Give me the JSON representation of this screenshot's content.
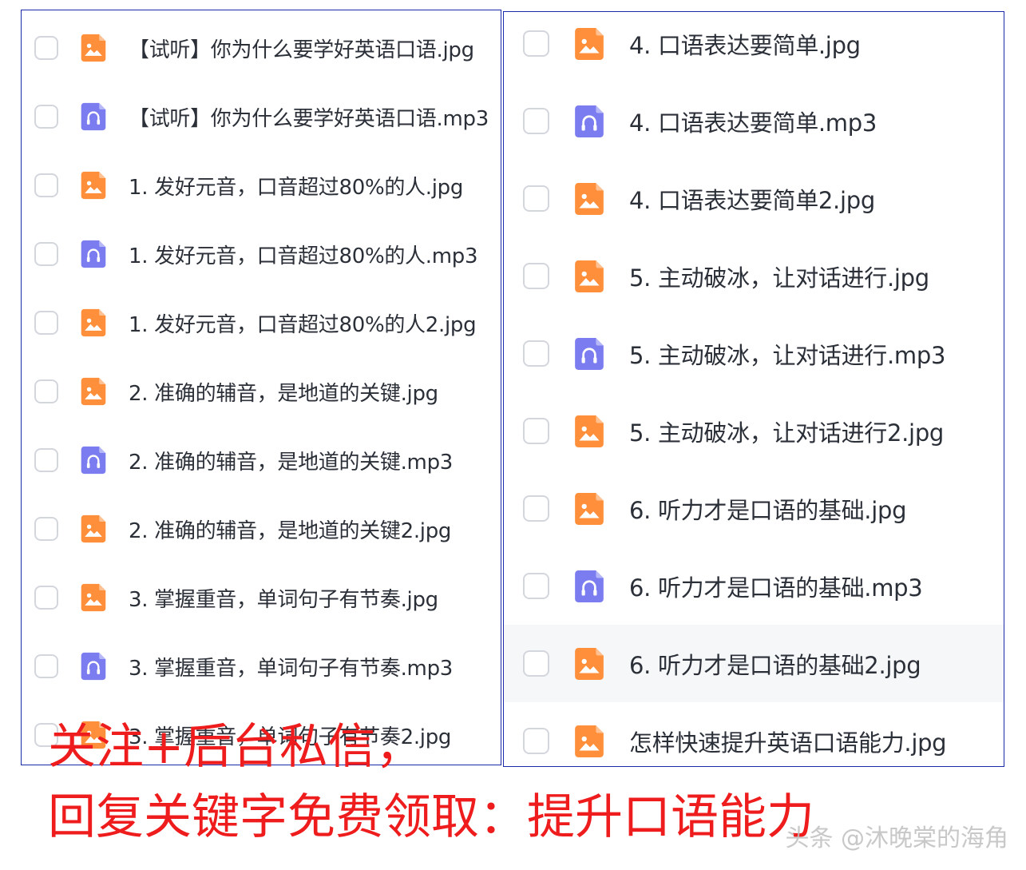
{
  "left_panel": {
    "files": [
      {
        "name": "【试听】你为什么要学好英语口语.jpg",
        "type": "image"
      },
      {
        "name": "【试听】你为什么要学好英语口语.mp3",
        "type": "audio"
      },
      {
        "name": "1. 发好元音，口音超过80%的人.jpg",
        "type": "image"
      },
      {
        "name": "1. 发好元音，口音超过80%的人.mp3",
        "type": "audio"
      },
      {
        "name": "1. 发好元音，口音超过80%的人2.jpg",
        "type": "image"
      },
      {
        "name": "2. 准确的辅音，是地道的关键.jpg",
        "type": "image"
      },
      {
        "name": "2. 准确的辅音，是地道的关键.mp3",
        "type": "audio"
      },
      {
        "name": "2. 准确的辅音，是地道的关键2.jpg",
        "type": "image"
      },
      {
        "name": "3. 掌握重音，单词句子有节奏.jpg",
        "type": "image"
      },
      {
        "name": "3. 掌握重音，单词句子有节奏.mp3",
        "type": "audio"
      },
      {
        "name": "3. 掌握重音，单词句子有节奏2.jpg",
        "type": "image"
      }
    ]
  },
  "right_panel": {
    "files": [
      {
        "name": "4. 口语表达要简单.jpg",
        "type": "image"
      },
      {
        "name": "4. 口语表达要简单.mp3",
        "type": "audio"
      },
      {
        "name": "4. 口语表达要简单2.jpg",
        "type": "image"
      },
      {
        "name": "5. 主动破冰，让对话进行.jpg",
        "type": "image"
      },
      {
        "name": "5. 主动破冰，让对话进行.mp3",
        "type": "audio"
      },
      {
        "name": "5. 主动破冰，让对话进行2.jpg",
        "type": "image"
      },
      {
        "name": "6. 听力才是口语的基础.jpg",
        "type": "image"
      },
      {
        "name": "6. 听力才是口语的基础.mp3",
        "type": "audio"
      },
      {
        "name": "6. 听力才是口语的基础2.jpg",
        "type": "image",
        "hovered": true
      },
      {
        "name": "怎样快速提升英语口语能力.jpg",
        "type": "image"
      }
    ]
  },
  "overlay": {
    "line1": "关注+后台私信，",
    "line2": "回复关键字免费领取：提升口语能力"
  },
  "watermark": "头条 @沐晚棠的海角",
  "colors": {
    "image_icon": "#ff8f3a",
    "audio_icon": "#7b7cf0",
    "overlay_text": "#ee1c1c",
    "panel_border": "#1b2aa8"
  },
  "icons": {
    "image": "image-file-icon",
    "audio": "audio-file-icon"
  }
}
